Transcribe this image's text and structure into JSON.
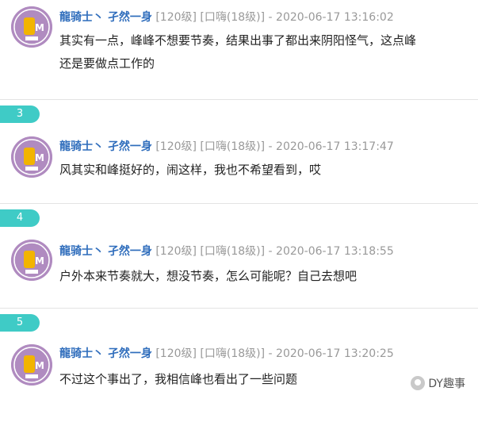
{
  "comments": [
    {
      "user": "龍骑士丶 孑然一身",
      "level": "[120级] [口嗨(18级)]",
      "time": "- 2020-06-17 13:16:02",
      "text_line1": "其实有一点，峰峰不想要节奏，结果出事了都出来阴阳怪气，这点峰",
      "text_line2": "还是要做点工作的"
    },
    {
      "floor": "3",
      "user": "龍骑士丶 孑然一身",
      "level": "[120级] [口嗨(18级)]",
      "time": "- 2020-06-17 13:17:47",
      "text_line1": "风其实和峰挺好的，闹这样，我也不希望看到，哎"
    },
    {
      "floor": "4",
      "user": "龍骑士丶 孑然一身",
      "level": "[120级] [口嗨(18级)]",
      "time": "- 2020-06-17 13:18:55",
      "text_line1": "户外本来节奏就大，想没节奏，怎么可能呢？自己去想吧"
    },
    {
      "floor": "5",
      "user": "龍骑士丶 孑然一身",
      "level": "[120级] [口嗨(18级)]",
      "time": "- 2020-06-17 13:20:25",
      "text_line1": "不过这个事出了，我相信峰也看出了一些问题"
    }
  ],
  "watermark": "DY趣事",
  "colors": {
    "username": "#2f6dbc",
    "meta": "#999999",
    "floor_tab": "#3fcbc6",
    "divider": "#e3e3e3"
  }
}
